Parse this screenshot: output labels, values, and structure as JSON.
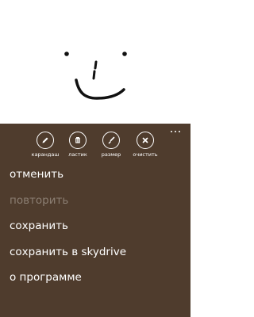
{
  "canvas": {
    "drawing": "smiley-face-drawing"
  },
  "appbar": {
    "background": "#4f3c2d",
    "buttons": [
      {
        "label": "карандаш",
        "icon": "pencil-icon"
      },
      {
        "label": "ластик",
        "icon": "eraser-icon"
      },
      {
        "label": "размер",
        "icon": "brush-size-icon"
      },
      {
        "label": "очистить",
        "icon": "clear-icon"
      }
    ],
    "more_icon": "ellipsis-icon"
  },
  "menu": {
    "items": [
      {
        "label": "отменить",
        "enabled": true
      },
      {
        "label": "повторить",
        "enabled": false
      },
      {
        "label": "сохранить",
        "enabled": true
      },
      {
        "label": "сохранить в skydrive",
        "enabled": true
      },
      {
        "label": "о программе",
        "enabled": true
      }
    ],
    "disabled_color": "#8b7e72"
  }
}
